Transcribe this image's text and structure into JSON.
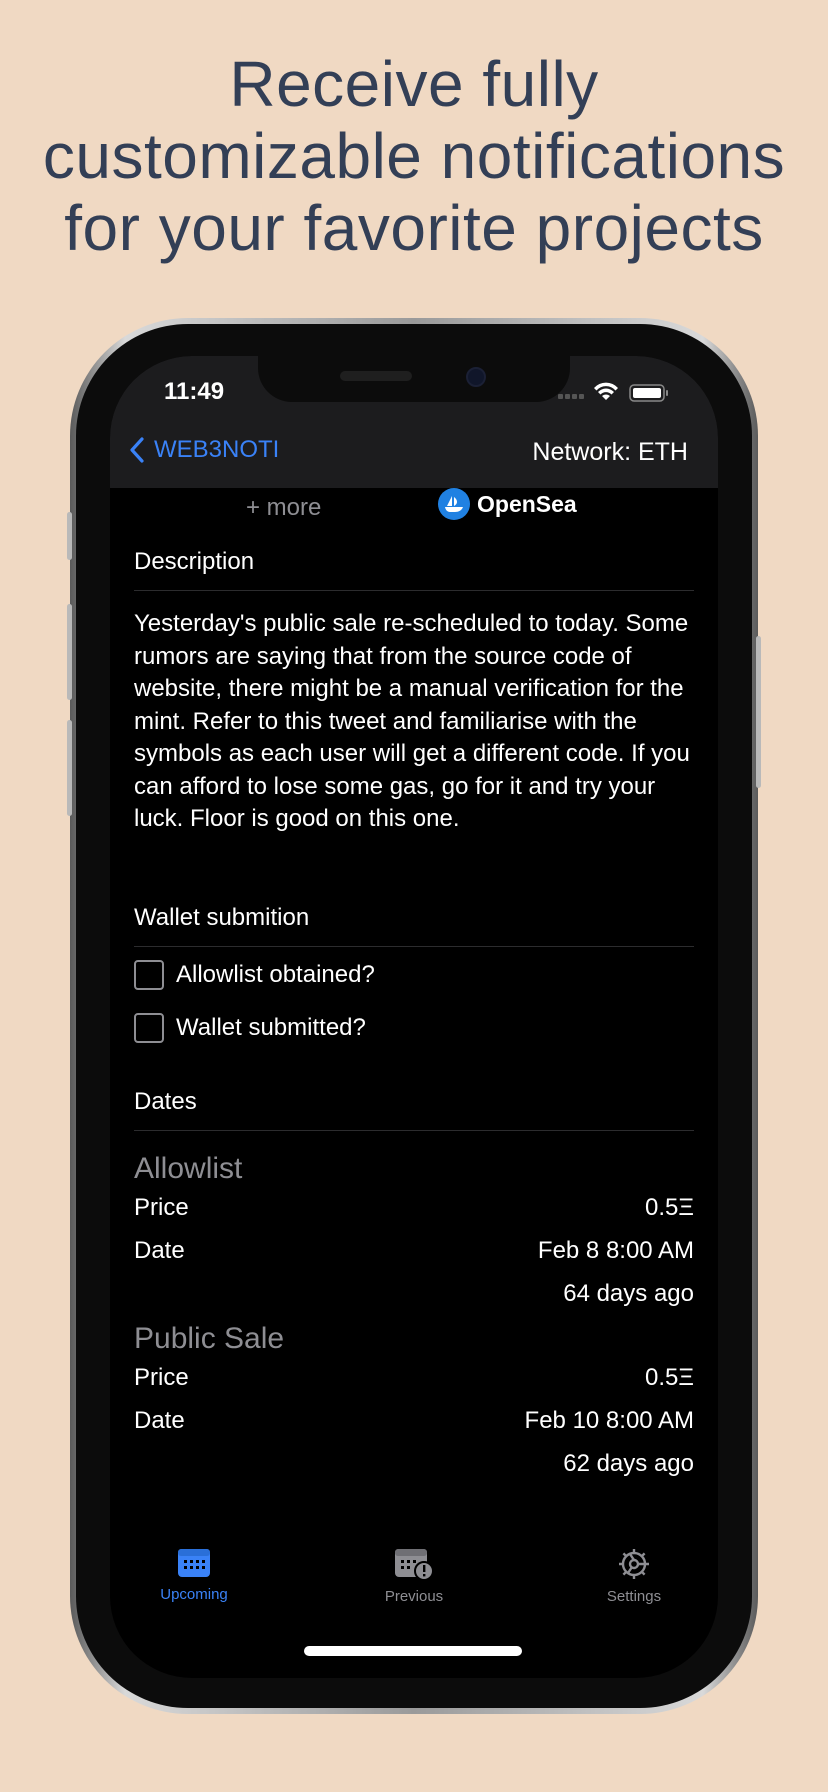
{
  "headline": {
    "line1": "Receive fully",
    "line2": "customizable notifications",
    "line3": "for your favorite projects"
  },
  "status_bar": {
    "time": "11:49"
  },
  "nav": {
    "back_label": "WEB3NOTI",
    "network_label": "Network: ETH"
  },
  "links": {
    "more_label": "+ more",
    "opensea_label": "OpenSea"
  },
  "description": {
    "heading": "Description",
    "text": "Yesterday's public sale re-scheduled to today. Some rumors are saying that from the source code of website, there might be a manual verification for the mint. Refer to this tweet and familiarise with the symbols as each user will get a different code. If you can afford to lose some gas, go for it and try your luck. Floor is good on this one."
  },
  "wallet": {
    "heading": "Wallet submition",
    "items": [
      {
        "label": "Allowlist obtained?",
        "checked": false
      },
      {
        "label": "Wallet submitted?",
        "checked": false
      }
    ]
  },
  "dates": {
    "heading": "Dates",
    "phases": [
      {
        "title": "Allowlist",
        "price_label": "Price",
        "price": "0.5Ξ",
        "date_label": "Date",
        "date": "Feb 8 8:00 AM",
        "relative": "64 days ago"
      },
      {
        "title": "Public Sale",
        "price_label": "Price",
        "price": "0.5Ξ",
        "date_label": "Date",
        "date": "Feb 10 8:00 AM",
        "relative": "62 days ago"
      }
    ]
  },
  "tabbar": {
    "tabs": [
      {
        "label": "Upcoming",
        "icon": "calendar-icon",
        "active": true
      },
      {
        "label": "Previous",
        "icon": "calendar-alert-icon",
        "active": false
      },
      {
        "label": "Settings",
        "icon": "gear-icon",
        "active": false
      }
    ]
  },
  "colors": {
    "background": "#f0d9c3",
    "headline": "#333f56",
    "accent": "#3a82f7",
    "inactive": "#8e8e93"
  }
}
